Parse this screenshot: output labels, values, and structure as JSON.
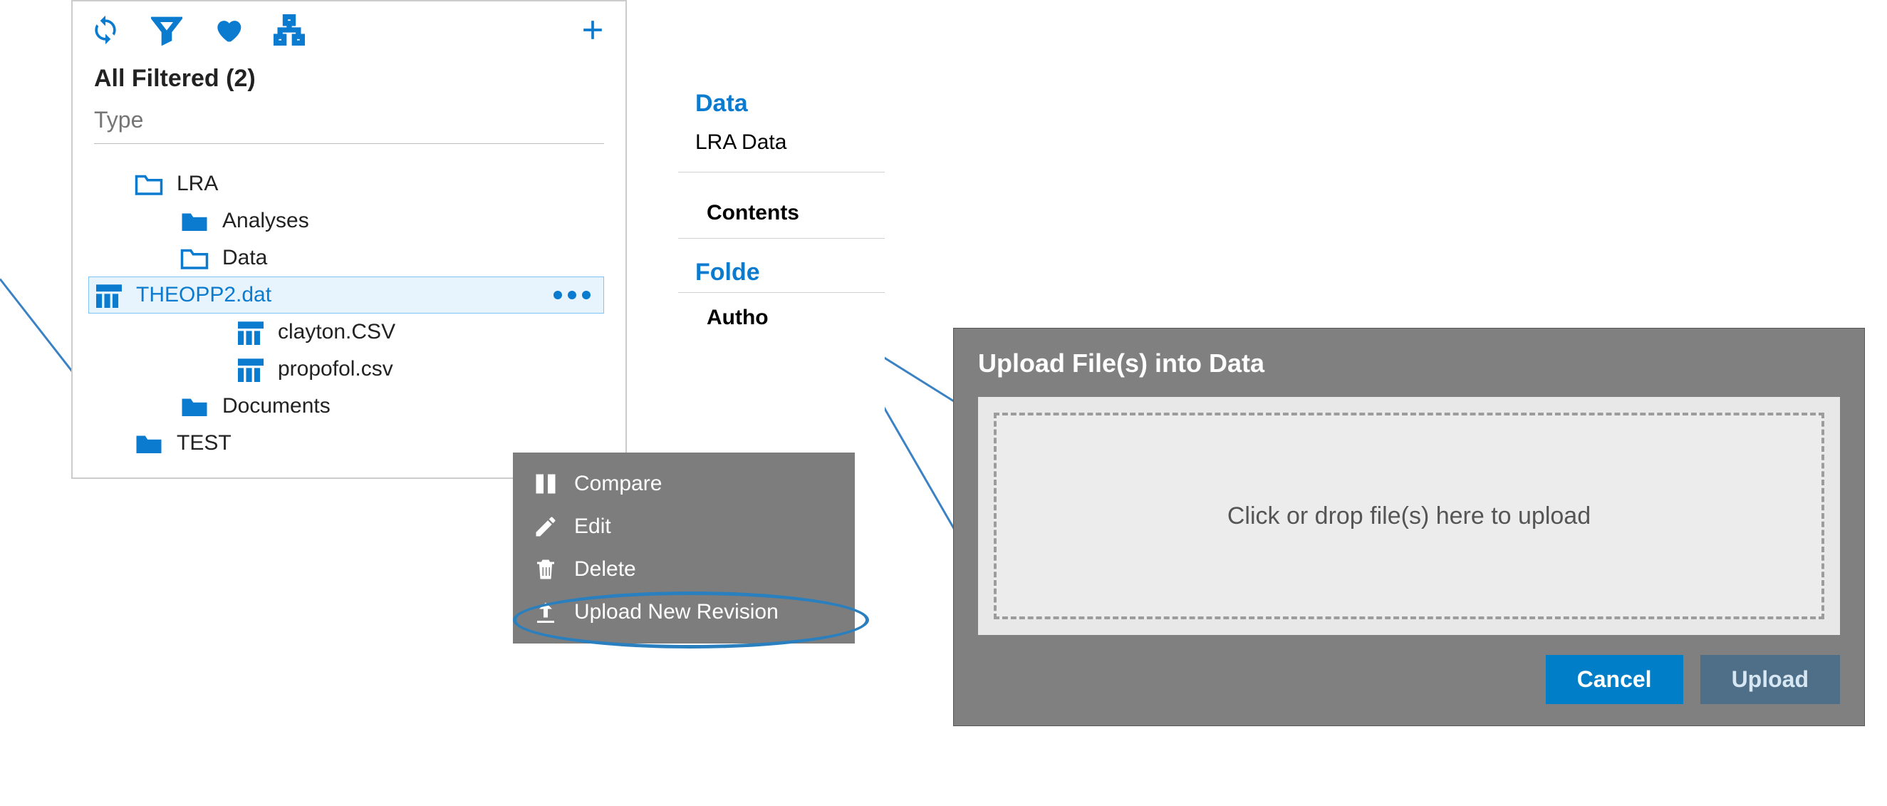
{
  "toolbar": {},
  "filter_panel": {
    "title": "All Filtered (2)",
    "type_placeholder": "Type"
  },
  "tree": {
    "root": "LRA",
    "analyses": "Analyses",
    "data": "Data",
    "file1": "THEOPP2.dat",
    "file2": "clayton.CSV",
    "file3": "propofol.csv",
    "documents": "Documents",
    "test": "TEST"
  },
  "context_menu": {
    "compare": "Compare",
    "edit": "Edit",
    "delete": "Delete",
    "upload_rev": "Upload New Revision"
  },
  "details": {
    "data_header": "Data",
    "data_sub": "LRA Data",
    "contents": "Contents",
    "folder": "Folde",
    "author": "Autho"
  },
  "dialog": {
    "title": "Upload File(s) into Data",
    "dropzone": "Click or drop file(s) here to upload",
    "cancel": "Cancel",
    "upload": "Upload"
  }
}
